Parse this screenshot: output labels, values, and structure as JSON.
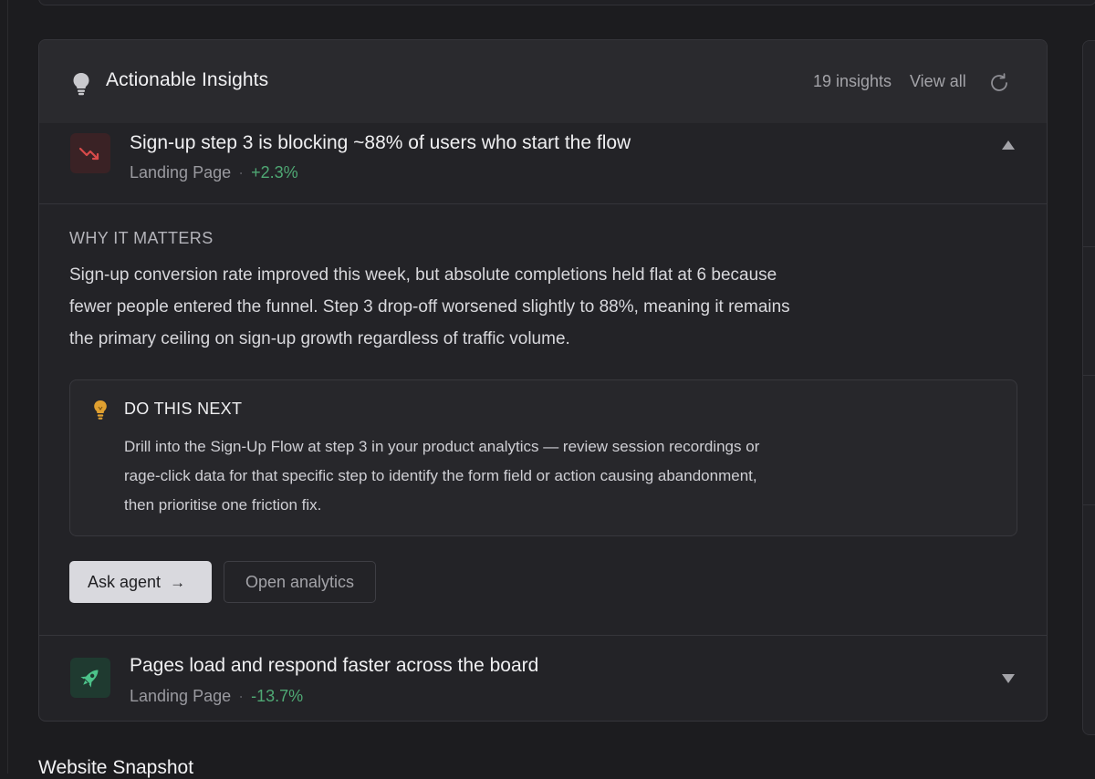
{
  "insights_panel": {
    "title": "Actionable Insights",
    "count": "19 insights",
    "view_all": "View all",
    "items": [
      {
        "title": "Sign-up step 3 is blocking ~88% of users who start the flow",
        "page": "Landing Page",
        "delta": "+2.3%",
        "icon": "trend-down-icon",
        "expanded": true,
        "why_label": "WHY IT MATTERS",
        "why_text": "Sign-up conversion rate improved this week, but absolute completions held flat at 6 because fewer people entered the funnel. Step 3 drop-off worsened slightly to 88%, meaning it remains the primary ceiling on sign-up growth regardless of traffic volume.",
        "next_label": "DO THIS NEXT",
        "next_text": "Drill into the Sign-Up Flow at step 3 in your product analytics — review session recordings or rage-click data for that specific step to identify the form field or action causing abandonment, then prioritise one friction fix.",
        "actions": {
          "primary": "Ask agent",
          "secondary": "Open analytics"
        }
      },
      {
        "title": "Pages load and respond faster across the board",
        "page": "Landing Page",
        "delta": "-13.7%",
        "icon": "rocket-icon",
        "expanded": false
      }
    ]
  },
  "next_section": {
    "title": "Website Snapshot"
  },
  "colors": {
    "background": "#1c1c1f",
    "panel": "#232327",
    "positive": "#4fa874",
    "negative_icon": "#d84a4a",
    "rocket": "#4cc38a",
    "bulb": "#e0a030"
  }
}
